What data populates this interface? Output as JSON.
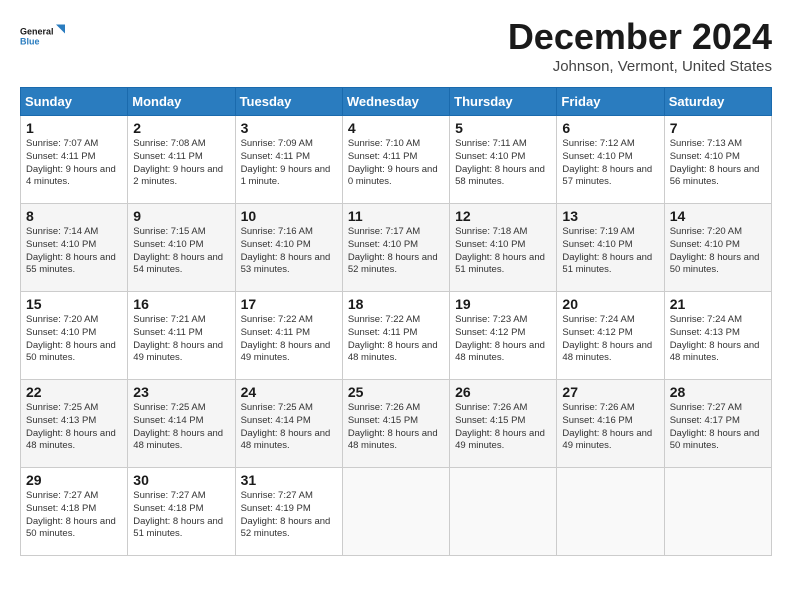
{
  "logo": {
    "line1": "General",
    "line2": "Blue"
  },
  "title": "December 2024",
  "subtitle": "Johnson, Vermont, United States",
  "header_days": [
    "Sunday",
    "Monday",
    "Tuesday",
    "Wednesday",
    "Thursday",
    "Friday",
    "Saturday"
  ],
  "weeks": [
    [
      {
        "day": "1",
        "sunrise": "Sunrise: 7:07 AM",
        "sunset": "Sunset: 4:11 PM",
        "daylight": "Daylight: 9 hours and 4 minutes."
      },
      {
        "day": "2",
        "sunrise": "Sunrise: 7:08 AM",
        "sunset": "Sunset: 4:11 PM",
        "daylight": "Daylight: 9 hours and 2 minutes."
      },
      {
        "day": "3",
        "sunrise": "Sunrise: 7:09 AM",
        "sunset": "Sunset: 4:11 PM",
        "daylight": "Daylight: 9 hours and 1 minute."
      },
      {
        "day": "4",
        "sunrise": "Sunrise: 7:10 AM",
        "sunset": "Sunset: 4:11 PM",
        "daylight": "Daylight: 9 hours and 0 minutes."
      },
      {
        "day": "5",
        "sunrise": "Sunrise: 7:11 AM",
        "sunset": "Sunset: 4:10 PM",
        "daylight": "Daylight: 8 hours and 58 minutes."
      },
      {
        "day": "6",
        "sunrise": "Sunrise: 7:12 AM",
        "sunset": "Sunset: 4:10 PM",
        "daylight": "Daylight: 8 hours and 57 minutes."
      },
      {
        "day": "7",
        "sunrise": "Sunrise: 7:13 AM",
        "sunset": "Sunset: 4:10 PM",
        "daylight": "Daylight: 8 hours and 56 minutes."
      }
    ],
    [
      {
        "day": "8",
        "sunrise": "Sunrise: 7:14 AM",
        "sunset": "Sunset: 4:10 PM",
        "daylight": "Daylight: 8 hours and 55 minutes."
      },
      {
        "day": "9",
        "sunrise": "Sunrise: 7:15 AM",
        "sunset": "Sunset: 4:10 PM",
        "daylight": "Daylight: 8 hours and 54 minutes."
      },
      {
        "day": "10",
        "sunrise": "Sunrise: 7:16 AM",
        "sunset": "Sunset: 4:10 PM",
        "daylight": "Daylight: 8 hours and 53 minutes."
      },
      {
        "day": "11",
        "sunrise": "Sunrise: 7:17 AM",
        "sunset": "Sunset: 4:10 PM",
        "daylight": "Daylight: 8 hours and 52 minutes."
      },
      {
        "day": "12",
        "sunrise": "Sunrise: 7:18 AM",
        "sunset": "Sunset: 4:10 PM",
        "daylight": "Daylight: 8 hours and 51 minutes."
      },
      {
        "day": "13",
        "sunrise": "Sunrise: 7:19 AM",
        "sunset": "Sunset: 4:10 PM",
        "daylight": "Daylight: 8 hours and 51 minutes."
      },
      {
        "day": "14",
        "sunrise": "Sunrise: 7:20 AM",
        "sunset": "Sunset: 4:10 PM",
        "daylight": "Daylight: 8 hours and 50 minutes."
      }
    ],
    [
      {
        "day": "15",
        "sunrise": "Sunrise: 7:20 AM",
        "sunset": "Sunset: 4:10 PM",
        "daylight": "Daylight: 8 hours and 50 minutes."
      },
      {
        "day": "16",
        "sunrise": "Sunrise: 7:21 AM",
        "sunset": "Sunset: 4:11 PM",
        "daylight": "Daylight: 8 hours and 49 minutes."
      },
      {
        "day": "17",
        "sunrise": "Sunrise: 7:22 AM",
        "sunset": "Sunset: 4:11 PM",
        "daylight": "Daylight: 8 hours and 49 minutes."
      },
      {
        "day": "18",
        "sunrise": "Sunrise: 7:22 AM",
        "sunset": "Sunset: 4:11 PM",
        "daylight": "Daylight: 8 hours and 48 minutes."
      },
      {
        "day": "19",
        "sunrise": "Sunrise: 7:23 AM",
        "sunset": "Sunset: 4:12 PM",
        "daylight": "Daylight: 8 hours and 48 minutes."
      },
      {
        "day": "20",
        "sunrise": "Sunrise: 7:24 AM",
        "sunset": "Sunset: 4:12 PM",
        "daylight": "Daylight: 8 hours and 48 minutes."
      },
      {
        "day": "21",
        "sunrise": "Sunrise: 7:24 AM",
        "sunset": "Sunset: 4:13 PM",
        "daylight": "Daylight: 8 hours and 48 minutes."
      }
    ],
    [
      {
        "day": "22",
        "sunrise": "Sunrise: 7:25 AM",
        "sunset": "Sunset: 4:13 PM",
        "daylight": "Daylight: 8 hours and 48 minutes."
      },
      {
        "day": "23",
        "sunrise": "Sunrise: 7:25 AM",
        "sunset": "Sunset: 4:14 PM",
        "daylight": "Daylight: 8 hours and 48 minutes."
      },
      {
        "day": "24",
        "sunrise": "Sunrise: 7:25 AM",
        "sunset": "Sunset: 4:14 PM",
        "daylight": "Daylight: 8 hours and 48 minutes."
      },
      {
        "day": "25",
        "sunrise": "Sunrise: 7:26 AM",
        "sunset": "Sunset: 4:15 PM",
        "daylight": "Daylight: 8 hours and 48 minutes."
      },
      {
        "day": "26",
        "sunrise": "Sunrise: 7:26 AM",
        "sunset": "Sunset: 4:15 PM",
        "daylight": "Daylight: 8 hours and 49 minutes."
      },
      {
        "day": "27",
        "sunrise": "Sunrise: 7:26 AM",
        "sunset": "Sunset: 4:16 PM",
        "daylight": "Daylight: 8 hours and 49 minutes."
      },
      {
        "day": "28",
        "sunrise": "Sunrise: 7:27 AM",
        "sunset": "Sunset: 4:17 PM",
        "daylight": "Daylight: 8 hours and 50 minutes."
      }
    ],
    [
      {
        "day": "29",
        "sunrise": "Sunrise: 7:27 AM",
        "sunset": "Sunset: 4:18 PM",
        "daylight": "Daylight: 8 hours and 50 minutes."
      },
      {
        "day": "30",
        "sunrise": "Sunrise: 7:27 AM",
        "sunset": "Sunset: 4:18 PM",
        "daylight": "Daylight: 8 hours and 51 minutes."
      },
      {
        "day": "31",
        "sunrise": "Sunrise: 7:27 AM",
        "sunset": "Sunset: 4:19 PM",
        "daylight": "Daylight: 8 hours and 52 minutes."
      },
      null,
      null,
      null,
      null
    ]
  ]
}
